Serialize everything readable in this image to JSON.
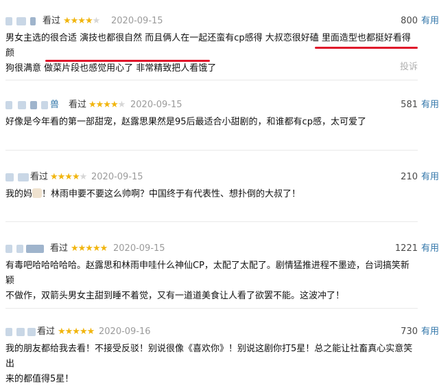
{
  "reviews": [
    {
      "seen": "看过",
      "rating": 4,
      "date": "2020-09-15",
      "votes": "800",
      "useful": "有用",
      "line1": "男女主选的很合适 演技也都很自然 而且俩人在一起还蛮有cp感得 大叔恋很好磕 里面造型也都挺好看得 颜",
      "line2": "狗很满意 做菜片段也感觉用心了 非常精致把人看饿了",
      "report": "投诉"
    },
    {
      "name_suffix": "兽",
      "seen": "看过",
      "rating": 4,
      "date": "2020-09-15",
      "votes": "581",
      "useful": "有用",
      "line1": "好像是今年看的第一部甜宠，赵露思果然是95后最适合小甜剧的，和谁都有cp感，太可爱了"
    },
    {
      "seen": "看过",
      "rating": 4,
      "date": "2020-09-15",
      "votes": "210",
      "useful": "有用",
      "line1a": "我的妈",
      "line1b": "！林雨申要不要这么帅啊？中国终于有代表性、想扑倒的大叔了！"
    },
    {
      "seen": "看过",
      "rating": 5,
      "date": "2020-09-15",
      "votes": "1221",
      "useful": "有用",
      "line1": "有毒吧哈哈哈哈哈。赵露思和林雨申哇什么神仙CP，太配了太配了。剧情猛推进程不墨迹，台词搞笑新颖",
      "line2": "不做作，双箭头男女主甜到睡不着觉，又有一道道美食让人看了欲罢不能。这波冲了！"
    },
    {
      "seen": "看过",
      "rating": 5,
      "date": "2020-09-16",
      "votes": "730",
      "useful": "有用",
      "line1": "我的朋友都给我去看！不接受反驳！别说很像《喜欢你》！别说这剧你打5星！总之能让社畜真心实意笑出",
      "line2": "来的都值得5星！"
    }
  ],
  "colors": {
    "star": "#f1b50e",
    "link": "#3377aa",
    "highlight": "#e0152a"
  }
}
